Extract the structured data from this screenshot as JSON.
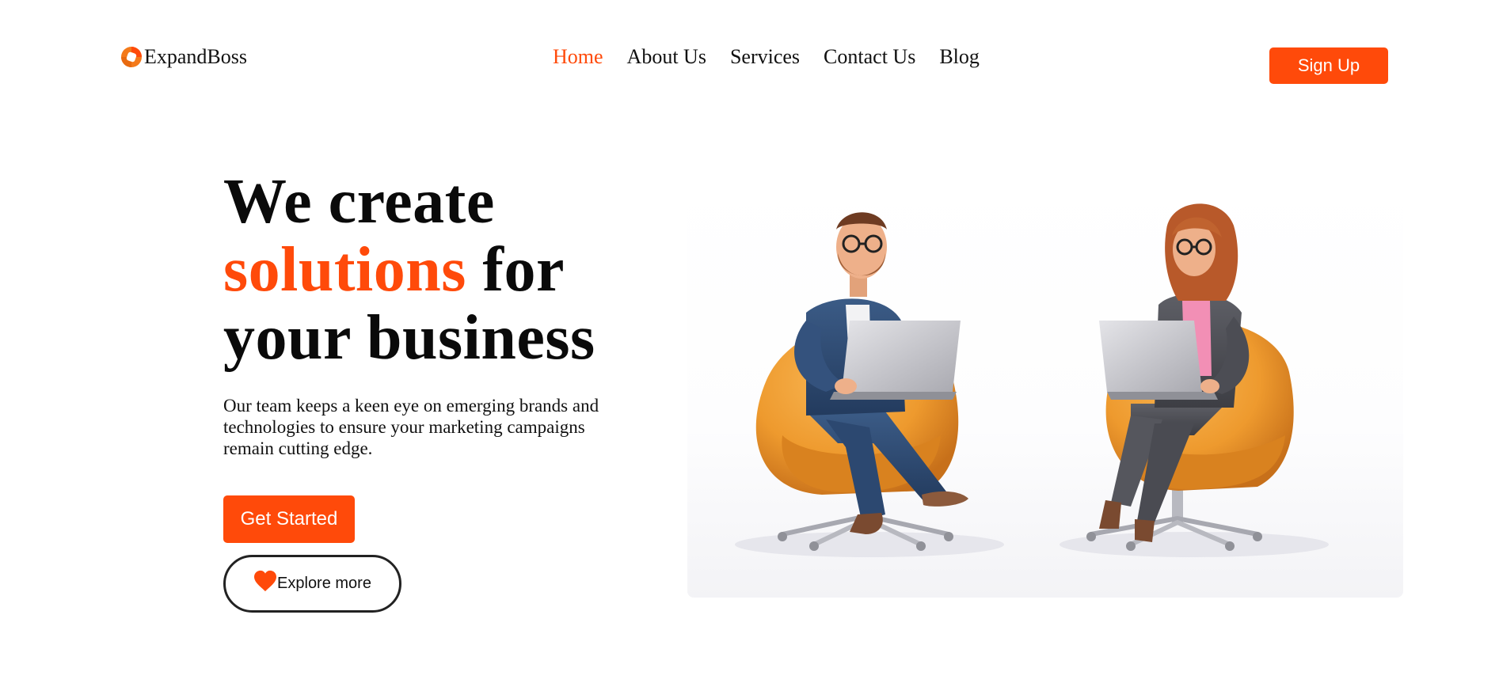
{
  "brand": {
    "name": "ExpandBoss",
    "accent_color": "#ff4a0a"
  },
  "nav": {
    "items": [
      {
        "label": "Home",
        "active": true
      },
      {
        "label": "About Us",
        "active": false
      },
      {
        "label": "Services",
        "active": false
      },
      {
        "label": "Contact Us",
        "active": false
      },
      {
        "label": "Blog",
        "active": false
      }
    ]
  },
  "header": {
    "signup_label": "Sign Up"
  },
  "hero": {
    "title_line1": "We create",
    "title_accent": "solutions",
    "title_line2_rest": " for",
    "title_line3": "your business",
    "description": "Our team keeps a keen eye on emerging brands and technologies to ensure your marketing campaigns remain cutting edge.",
    "primary_cta": "Get Started",
    "secondary_cta": "Explore more",
    "secondary_cta_icon": "heart-icon"
  },
  "illustration": {
    "subject": "two-people-on-laptops-in-egg-chairs"
  }
}
